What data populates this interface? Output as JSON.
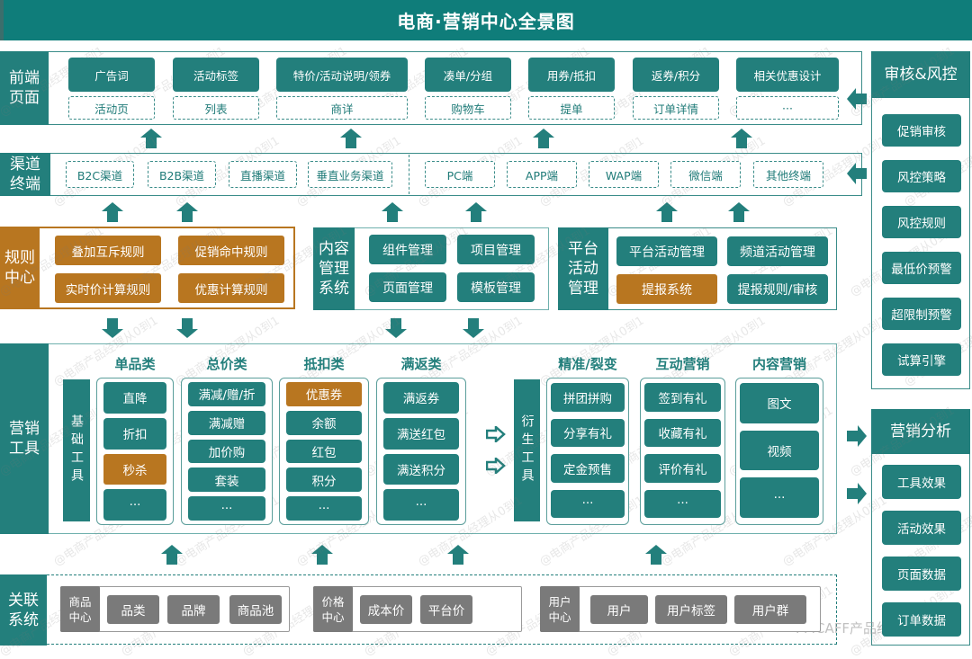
{
  "title": "电商·营销中心全景图",
  "colors": {
    "teal": "#237f7c",
    "header_teal": "#0f7d7a",
    "orange": "#b87620",
    "gray": "#7a7a7a"
  },
  "frontend": {
    "label": "前端\n页面",
    "items": [
      {
        "top": "广告词",
        "bottom": "活动页"
      },
      {
        "top": "活动标签",
        "bottom": "列表"
      },
      {
        "top": "特价/活动说明/领券",
        "bottom": "商详"
      },
      {
        "top": "凑单/分组",
        "bottom": "购物车"
      },
      {
        "top": "用券/抵扣",
        "bottom": "提单"
      },
      {
        "top": "返券/积分",
        "bottom": "订单详情"
      },
      {
        "top": "相关优惠设计",
        "bottom": "···"
      }
    ]
  },
  "channels": {
    "label": "渠道\n终端",
    "left": [
      "B2C渠道",
      "B2B渠道",
      "直播渠道",
      "垂直业务渠道"
    ],
    "right": [
      "PC端",
      "APP端",
      "WAP端",
      "微信端",
      "其他终端"
    ]
  },
  "rules_center": {
    "label": "规则\n中心",
    "items": [
      "叠加互斥规则",
      "促销命中规则",
      "实时价计算规则",
      "优惠计算规则"
    ]
  },
  "cms": {
    "label": "内容\n管理\n系统",
    "items": [
      "组件管理",
      "项目管理",
      "页面管理",
      "模板管理"
    ]
  },
  "platform": {
    "label": "平台\n活动\n管理",
    "items": [
      {
        "text": "平台活动管理",
        "highlight": false
      },
      {
        "text": "频道活动管理",
        "highlight": false
      },
      {
        "text": "提报系统",
        "highlight": true
      },
      {
        "text": "提报规则/审核",
        "highlight": false
      }
    ]
  },
  "marketing_tools": {
    "label": "营销\n工具",
    "basic_label": "基础工具",
    "derived_label": "衍生工具",
    "basic_columns": [
      {
        "title": "单品类",
        "items": [
          {
            "text": "直降"
          },
          {
            "text": "折扣"
          },
          {
            "text": "秒杀",
            "highlight": true
          },
          {
            "text": "···"
          }
        ]
      },
      {
        "title": "总价类",
        "items": [
          {
            "text": "满减/赠/折"
          },
          {
            "text": "满减赠"
          },
          {
            "text": "加价购"
          },
          {
            "text": "套装"
          },
          {
            "text": "···"
          }
        ]
      },
      {
        "title": "抵扣类",
        "items": [
          {
            "text": "优惠券",
            "highlight": true
          },
          {
            "text": "余额"
          },
          {
            "text": "红包"
          },
          {
            "text": "积分"
          },
          {
            "text": "···"
          }
        ]
      },
      {
        "title": "满返类",
        "items": [
          {
            "text": "满返券"
          },
          {
            "text": "满送红包"
          },
          {
            "text": "满送积分"
          },
          {
            "text": "···"
          }
        ]
      }
    ],
    "derived_columns": [
      {
        "title": "精准/裂变",
        "items": [
          {
            "text": "拼团拼购"
          },
          {
            "text": "分享有礼"
          },
          {
            "text": "定金预售"
          },
          {
            "text": "···"
          }
        ]
      },
      {
        "title": "互动营销",
        "items": [
          {
            "text": "签到有礼"
          },
          {
            "text": "收藏有礼"
          },
          {
            "text": "评价有礼"
          },
          {
            "text": "···"
          }
        ]
      },
      {
        "title": "内容营销",
        "items": [
          {
            "text": "图文"
          },
          {
            "text": "视频"
          },
          {
            "text": "···"
          }
        ]
      }
    ]
  },
  "related_systems": {
    "label": "关联\n系统",
    "groups": [
      {
        "name": "商品\n中心",
        "items": [
          "品类",
          "品牌",
          "商品池"
        ]
      },
      {
        "name": "价格\n中心",
        "items": [
          "成本价",
          "平台价"
        ]
      },
      {
        "name": "用户\n中心",
        "items": [
          "用户",
          "用户标签",
          "用户群"
        ]
      }
    ]
  },
  "audit_risk": {
    "title": "审核&风控",
    "items": [
      "促销审核",
      "风控策略",
      "风控规则",
      "最低价预警",
      "超限制预警",
      "试算引擎"
    ]
  },
  "analysis": {
    "title": "营销分析",
    "items": [
      "工具效果",
      "活动效果",
      "页面数据",
      "订单数据"
    ]
  },
  "watermark": "@电商产品经理从0到1",
  "footer_logo": "PMCAFF产品经理社区"
}
